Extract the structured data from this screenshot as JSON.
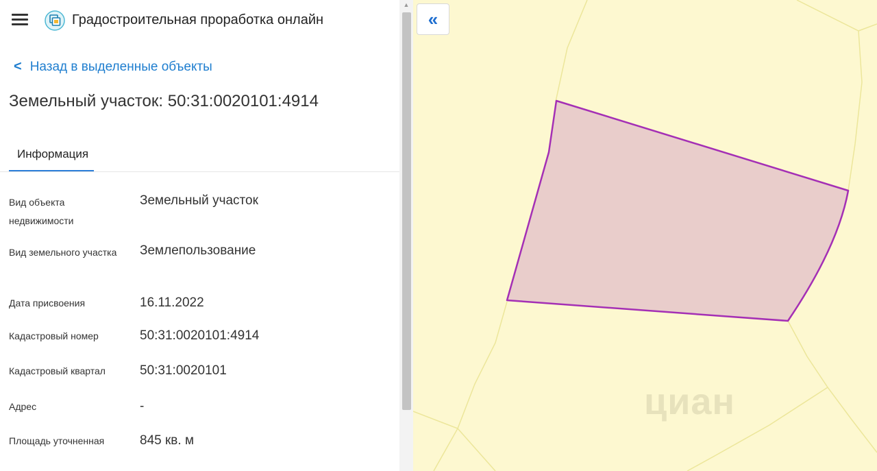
{
  "header": {
    "app_title": "Градостроительная проработка онлайн",
    "menu_icon": "hamburger-icon",
    "logo_icon": "layers-logo-icon"
  },
  "back_link": {
    "label": "Назад в выделенные объекты",
    "icon": "chevron-left-icon"
  },
  "page_title": "Земельный участок: 50:31:0020101:4914",
  "tabs": [
    {
      "label": "Информация",
      "active": true
    }
  ],
  "info_rows": [
    {
      "label": "Вид объекта недвижимости",
      "value": "Земельный участок"
    },
    {
      "label": "Вид земельного участка",
      "value": "Землепользование"
    },
    {
      "label": "Дата присвоения",
      "value": "16.11.2022"
    },
    {
      "label": "Кадастровый номер",
      "value": "50:31:0020101:4914"
    },
    {
      "label": "Кадастровый квартал",
      "value": "50:31:0020101"
    },
    {
      "label": "Адрес",
      "value": "-"
    },
    {
      "label": "Площадь уточненная",
      "value": "845 кв. м"
    }
  ],
  "map": {
    "collapse_button": "«",
    "watermark": "циан",
    "colors": {
      "background": "#fdf8d0",
      "parcel_lines": "#ece69a",
      "selected_fill": "#e9cdcb",
      "selected_stroke": "#a42fb5",
      "accent": "#1f7ecf"
    }
  }
}
